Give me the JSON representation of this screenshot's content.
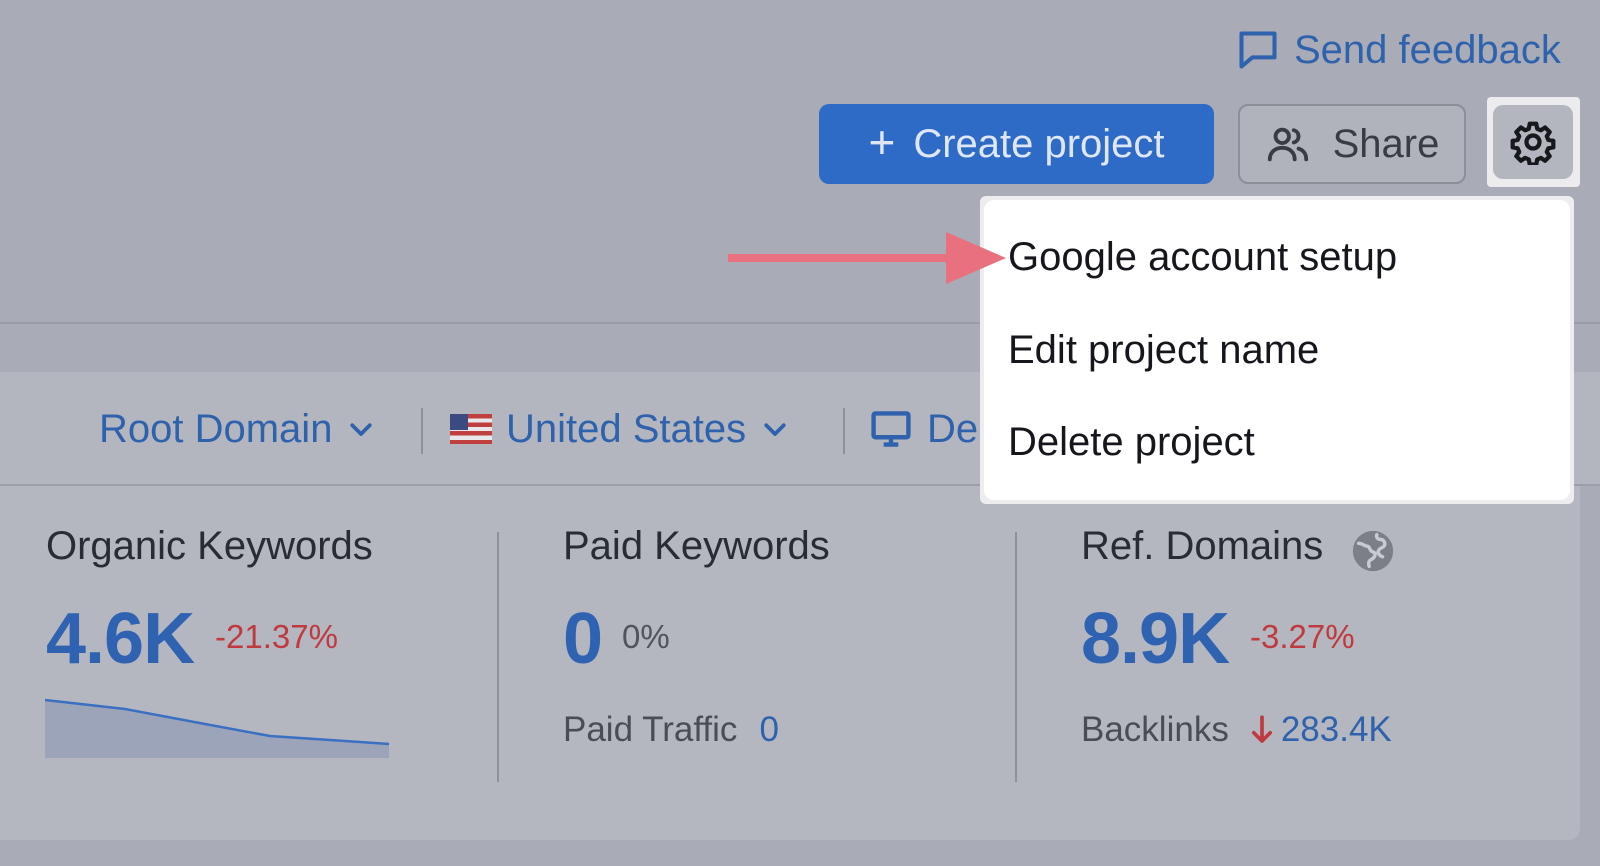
{
  "header": {
    "feedback_label": "Send feedback",
    "create_label": "Create project",
    "create_icon": "+",
    "share_label": "Share"
  },
  "filters": {
    "root_domain": "Root Domain",
    "country": "United States",
    "device_partial": "De"
  },
  "menu": {
    "items": [
      "Google account setup",
      "Edit project name",
      "Delete project"
    ]
  },
  "stats": {
    "organic": {
      "label": "Organic Keywords",
      "value": "4.6K",
      "delta": "-21.37%"
    },
    "paid": {
      "label": "Paid Keywords",
      "value": "0",
      "delta": "0%",
      "sub_label": "Paid Traffic",
      "sub_value": "0"
    },
    "ref": {
      "label": "Ref. Domains",
      "value": "8.9K",
      "delta": "-3.27%",
      "sub_label": "Backlinks",
      "sub_value": "283.4K"
    }
  },
  "colors": {
    "accent": "#2e6bc6",
    "link": "#2f62ad",
    "negative": "#c0393e",
    "annotation_arrow": "#e9707f"
  },
  "icons": {
    "feedback": "speech-bubble-icon",
    "share": "users-icon",
    "settings": "gear-icon",
    "device": "monitor-icon",
    "ref_domains": "globe-icon",
    "backlinks": "arrow-down-icon"
  }
}
